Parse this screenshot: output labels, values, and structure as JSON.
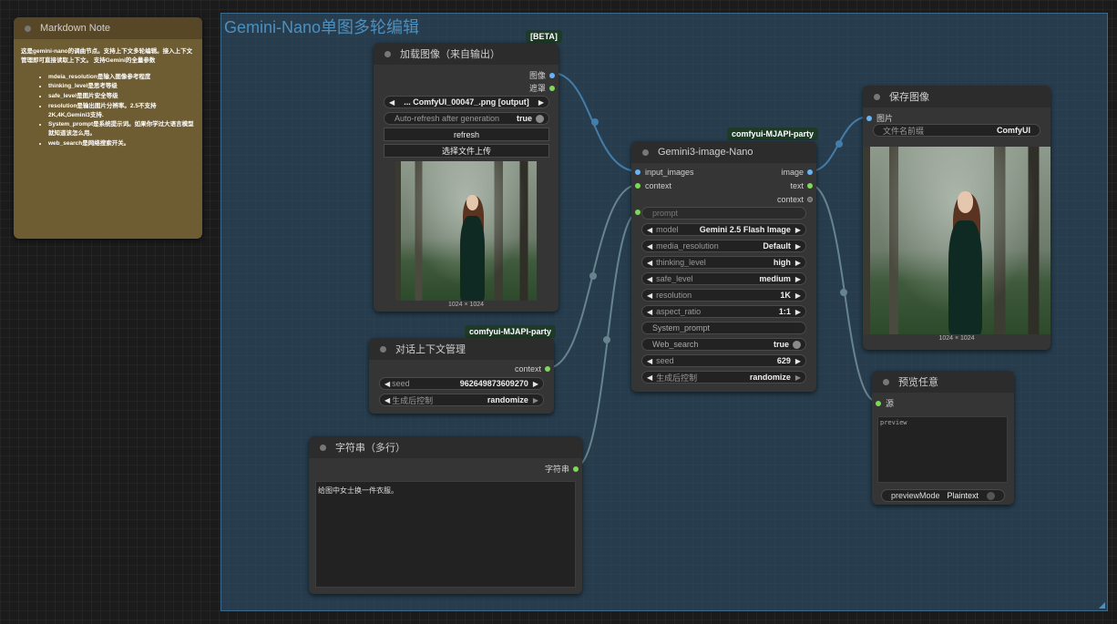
{
  "group": {
    "title": "Gemini-Nano单图多轮编辑"
  },
  "note": {
    "title": "Markdown Note",
    "intro": "这是gemini-nano的调曲节点。支持上下文多轮编辑。接入上下文管理即可直接读取上下文。 支持Gemini的全量参数",
    "items": [
      "mdeia_resolution是输入图像参考程度",
      "thinking_level是思考等级",
      "safe_level是图片安全等级",
      "resolution是输出图片分辨率。2.5不支持2K,4K,Gemini3支持.",
      "System_prompt是系统提示词。如果你学过大语言模型就知道该怎么用。",
      "web_search是网络搜索开关。"
    ]
  },
  "load_image": {
    "badge": "[BETA]",
    "title": "加载图像（来自输出）",
    "outputs": [
      "图像",
      "遮罩"
    ],
    "file": "... ComfyUI_00047_.png [output]",
    "autorefresh_label": "Auto-refresh after generation",
    "autorefresh_value": "true",
    "refresh": "refresh",
    "upload": "选择文件上传",
    "size": "1024 × 1024"
  },
  "context_mgr": {
    "badge": "comfyui-MJAPI-party",
    "title": "对话上下文管理",
    "output": "context",
    "seed_label": "seed",
    "seed_value": "962649873609270",
    "ctrl_label": "生成后控制",
    "ctrl_value": "randomize"
  },
  "string_node": {
    "title": "字符串（多行）",
    "output": "字符串",
    "text": "给图中女士换一件衣服。"
  },
  "gemini": {
    "badge": "comfyui-MJAPI-party",
    "title": "Gemini3-image-Nano",
    "inputs": [
      "input_images",
      "context"
    ],
    "outputs": [
      "image",
      "text",
      "context"
    ],
    "prompt_placeholder": "prompt",
    "widgets": [
      {
        "label": "model",
        "value": "Gemini 2.5 Flash Image"
      },
      {
        "label": "media_resolution",
        "value": "Default"
      },
      {
        "label": "thinking_level",
        "value": "high"
      },
      {
        "label": "safe_level",
        "value": "medium"
      },
      {
        "label": "resolution",
        "value": "1K"
      },
      {
        "label": "aspect_ratio",
        "value": "1:1"
      }
    ],
    "system_prompt": "System_prompt",
    "web_search_label": "Web_search",
    "web_search_value": "true",
    "seed_label": "seed",
    "seed_value": "629",
    "ctrl_label": "生成后控制",
    "ctrl_value": "randomize"
  },
  "save_image": {
    "title": "保存图像",
    "input": "图片",
    "prefix_label": "文件名前缀",
    "prefix_value": "ComfyUI",
    "size": "1024 × 1024"
  },
  "preview": {
    "title": "预览任意",
    "input": "源",
    "text": "preview",
    "mode_label": "previewMode",
    "mode_value": "Plaintext"
  },
  "colors": {
    "image_socket": "#64b5f6",
    "context_socket": "#7ed957",
    "wire_image": "#5aa9e6",
    "wire_other": "#a9b8a8"
  }
}
